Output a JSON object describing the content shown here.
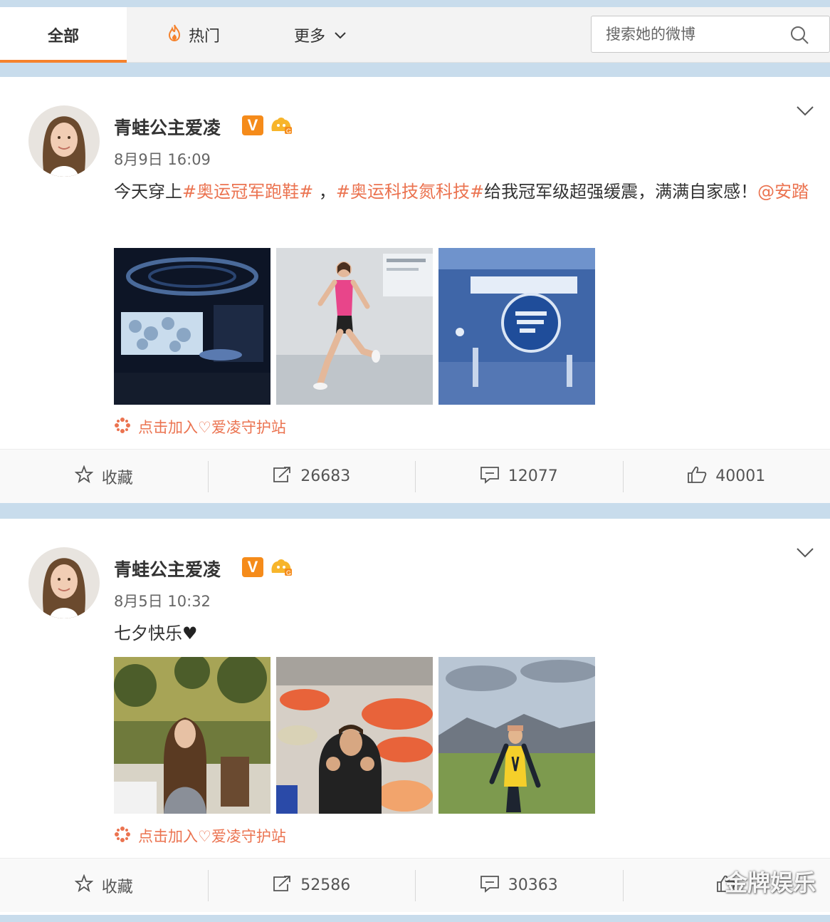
{
  "nav": {
    "tab_all": "全部",
    "tab_hot": "热门",
    "tab_more": "更多",
    "search_placeholder": "搜索她的微博"
  },
  "colors": {
    "accent": "#f5822c",
    "link": "#eb7350",
    "verified_badge": "#f58b1a"
  },
  "posts": [
    {
      "username": "青蛙公主爱凌",
      "verified_label": "V",
      "timestamp": "8月9日 16:09",
      "content": {
        "prefix": "今天穿上",
        "tag1": "#奥运冠军跑鞋#",
        "middle": " ，",
        "tag2": "#奥运科技氮科技#",
        "suffix": "给我冠军级超强缓震，满满自家感！",
        "mention": "@安踏"
      },
      "images": [
        "futuristic-exhibition-hall",
        "animated-runner",
        "blue-tech-showroom"
      ],
      "join_text": "点击加入♡爱凌守护站",
      "actions": {
        "favorite": "收藏",
        "reposts": "26683",
        "comments": "12077",
        "likes": "40001"
      }
    },
    {
      "username": "青蛙公主爱凌",
      "verified_label": "V",
      "timestamp": "8月5日 10:32",
      "content": {
        "text": "七夕快乐",
        "emoji": "♥"
      },
      "images": [
        "garden-cafe-portrait",
        "seafood-market-thumbs-up",
        "mountain-meadow-yellow-jacket"
      ],
      "join_text": "点击加入♡爱凌守护站",
      "actions": {
        "favorite": "收藏",
        "reposts": "52586",
        "comments": "30363"
      }
    }
  ],
  "watermark": "金牌娱乐"
}
